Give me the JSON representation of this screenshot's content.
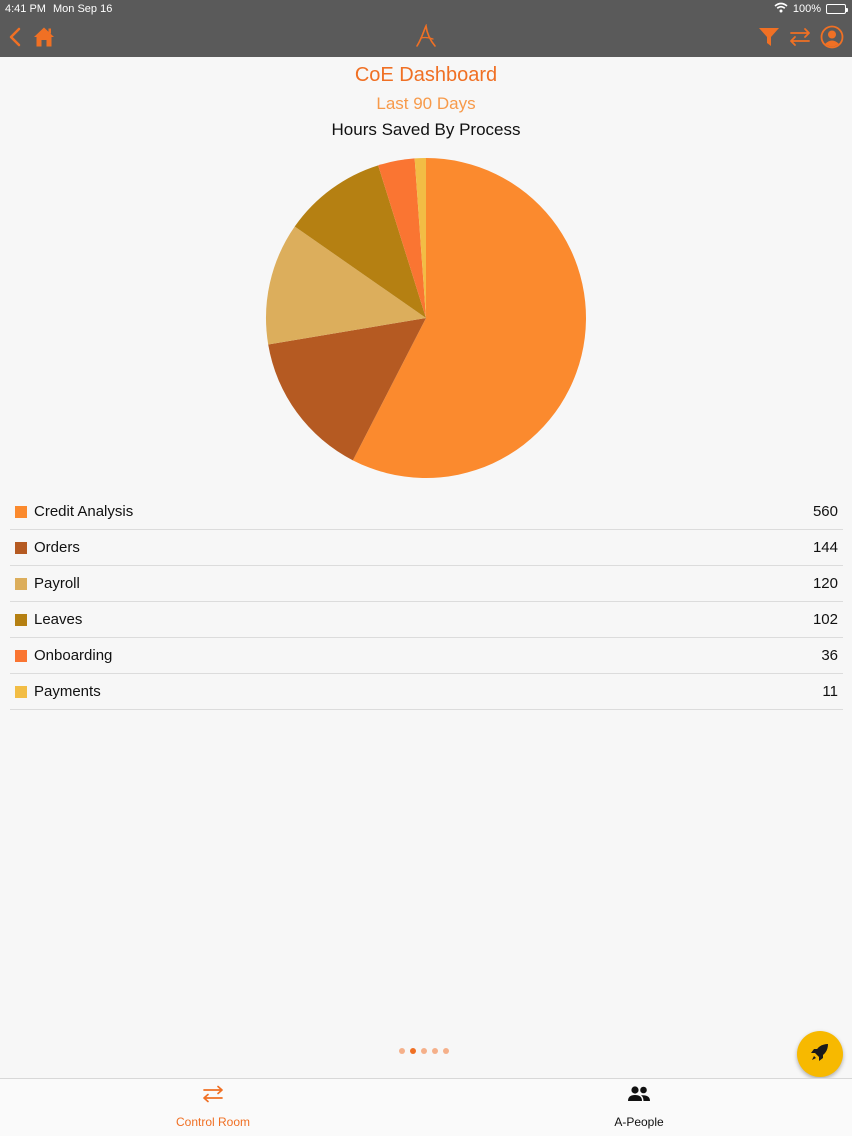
{
  "status_bar": {
    "time": "4:41 PM",
    "date": "Mon Sep 16",
    "battery": "100%"
  },
  "header": {
    "title": "CoE Dashboard",
    "subtitle": "Last 90 Days"
  },
  "chart_data": {
    "type": "pie",
    "title": "Hours Saved By Process",
    "categories": [
      "Credit Analysis",
      "Orders",
      "Payroll",
      "Leaves",
      "Onboarding",
      "Payments"
    ],
    "values": [
      560,
      144,
      120,
      102,
      36,
      11
    ],
    "colors": [
      "#fb8a2e",
      "#b55a22",
      "#dcae5c",
      "#b58012",
      "#fa7532",
      "#f2bd45"
    ]
  },
  "legend": [
    {
      "label": "Credit Analysis",
      "value": "560"
    },
    {
      "label": "Orders",
      "value": "144"
    },
    {
      "label": "Payroll",
      "value": "120"
    },
    {
      "label": "Leaves",
      "value": "102"
    },
    {
      "label": "Onboarding",
      "value": "36"
    },
    {
      "label": "Payments",
      "value": "11"
    }
  ],
  "pager": {
    "count": 5,
    "active": 2
  },
  "tabs": [
    {
      "label": "Control Room",
      "color": "#f07024",
      "icon": "swap-arrows-icon"
    },
    {
      "label": "A-People",
      "color": "#111111",
      "icon": "people-icon"
    }
  ],
  "colors": {
    "accent": "#f07024",
    "nav_bg": "#5a5a5a",
    "fab": "#f7b900"
  }
}
